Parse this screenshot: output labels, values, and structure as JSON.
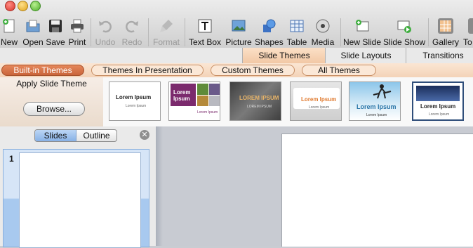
{
  "toolbar": {
    "items": [
      {
        "key": "new",
        "label": "New"
      },
      {
        "key": "open",
        "label": "Open"
      },
      {
        "key": "save",
        "label": "Save"
      },
      {
        "key": "print",
        "label": "Print"
      },
      {
        "key": "undo",
        "label": "Undo"
      },
      {
        "key": "redo",
        "label": "Redo"
      },
      {
        "key": "format",
        "label": "Format"
      },
      {
        "key": "textbox",
        "label": "Text Box"
      },
      {
        "key": "picture",
        "label": "Picture"
      },
      {
        "key": "shapes",
        "label": "Shapes"
      },
      {
        "key": "table",
        "label": "Table"
      },
      {
        "key": "media",
        "label": "Media"
      },
      {
        "key": "newslide",
        "label": "New Slide"
      },
      {
        "key": "slideshow",
        "label": "Slide Show"
      },
      {
        "key": "gallery",
        "label": "Gallery"
      },
      {
        "key": "toolbox",
        "label": "To"
      }
    ]
  },
  "ribbon_tabs": [
    "Slide Themes",
    "Slide Layouts",
    "Transitions"
  ],
  "gallery_tabs": [
    "Built-in Themes",
    "Themes In Presentation",
    "Custom Themes",
    "All Themes"
  ],
  "apply_panel": {
    "title": "Apply Slide Theme",
    "browse_label": "Browse..."
  },
  "theme_thumbs": [
    {
      "title": "Lorem Ipsum",
      "sub": "Lorem Ipsum",
      "bg": "#ffffff",
      "fg": "#222222"
    },
    {
      "title": "Lorem Ipsum",
      "sub": "Lorem Ipsum",
      "bg": "#7b2a6d",
      "fg": "#ffffff"
    },
    {
      "title": "LOREM IPSUM",
      "sub": "LOREM IPSUM",
      "bg": "#5c5c5c",
      "fg": "#e8b468"
    },
    {
      "title": "Lorem Ipsum",
      "sub": "Lorem Ipsum",
      "bg": "#e6e6e6",
      "fg": "#e07a2f"
    },
    {
      "title": "Lorem Ipsum",
      "sub": "Lorem Ipsum",
      "bg": "#d9ecf7",
      "fg": "#2b76a8"
    },
    {
      "title": "Lorem Ipsum",
      "sub": "Lorem Ipsum",
      "bg": "#ffffff",
      "fg": "#222222"
    }
  ],
  "slides_pane": {
    "tabs": [
      "Slides",
      "Outline"
    ],
    "slide_number": "1"
  }
}
